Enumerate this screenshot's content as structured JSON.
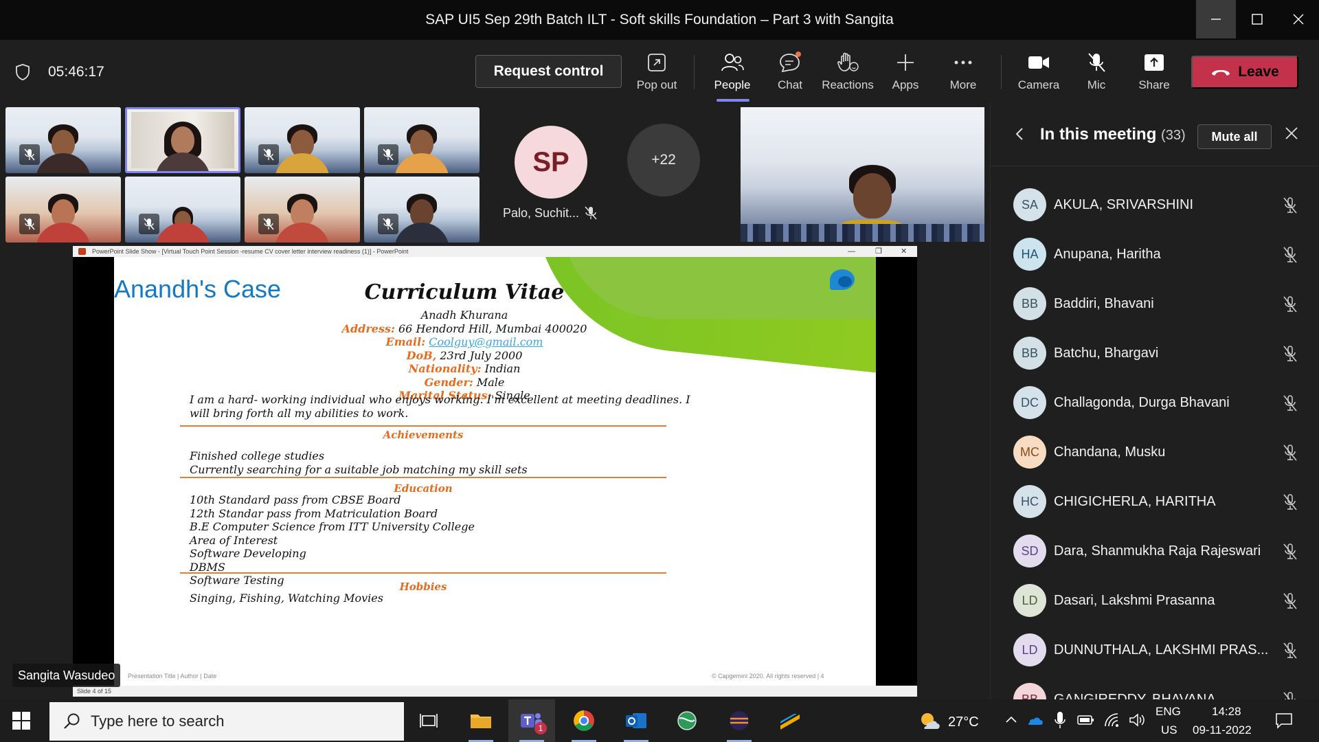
{
  "window": {
    "title": "SAP UI5 Sep 29th Batch ILT - Soft skills Foundation – Part 3 with Sangita"
  },
  "toolbar": {
    "timer": "05:46:17",
    "request_control": "Request control",
    "pop_out": "Pop out",
    "people": "People",
    "chat": "Chat",
    "reactions": "Reactions",
    "apps": "Apps",
    "more": "More",
    "camera": "Camera",
    "mic": "Mic",
    "share": "Share",
    "leave": "Leave"
  },
  "stage": {
    "avatar_initials": "SP",
    "avatar_name": "Palo, Suchit...",
    "overflow_count": "+22",
    "presenter_tag": "Sangita Wasudeo"
  },
  "ppt": {
    "window_title": "PowerPoint Slide Show - [Virtual Touch Point Session -resume CV cover letter interview readiness (1)] - PowerPoint",
    "slide_indicator": "Slide 4 of 15",
    "footer_left": "Presentation Title | Author | Date",
    "footer_right": "© Capgemini 2020. All rights reserved  |      4",
    "case_title": "Anandh's Case",
    "cv_heading": "Curriculum Vitae",
    "name": "Anadh Khurana",
    "address_label": "Address:",
    "address": " 66 Hendord Hill, Mumbai 400020",
    "email_label": "Email:",
    "email": "Coolguy@gmail.com",
    "dob_label": "DoB,",
    "dob": " 23rd July 2000",
    "nationality_label": "Nationality:",
    "nationality": " Indian",
    "gender_label": "Gender:",
    "gender": " Male",
    "marital_label": "Marital Status:",
    "marital": " Single",
    "summary_1": "I am a hard- working individual who enjoys working. I'm excellent at meeting deadlines. I",
    "summary_2": "will bring forth all my abilities to work.",
    "achievements_head": "Achievements",
    "achievements": [
      "Finished college studies",
      "Currently searching for a suitable job matching my skill sets"
    ],
    "education_head": "Education",
    "education": [
      "10th Standard pass from CBSE Board",
      "12th Standar pass from Matriculation Board",
      "B.E Computer Science from ITT University College",
      "Area of Interest",
      "Software Developing",
      "DBMS",
      "Software Testing"
    ],
    "hobbies_head": "Hobbies",
    "hobbies": "Singing, Fishing, Watching Movies"
  },
  "panel": {
    "title": "In this meeting",
    "count": "(33)",
    "mute_all": "Mute all",
    "participants": [
      {
        "initials": "SA",
        "name": "AKULA, SRIVARSHINI",
        "bg": "#d6e2ea",
        "fg": "#3c5166"
      },
      {
        "initials": "HA",
        "name": "Anupana, Haritha",
        "bg": "#cde3ee",
        "fg": "#1f5574"
      },
      {
        "initials": "BB",
        "name": "Baddiri, Bhavani",
        "bg": "#d3e0e6",
        "fg": "#36525f"
      },
      {
        "initials": "BB",
        "name": "Batchu, Bhargavi",
        "bg": "#d3e0e6",
        "fg": "#36525f"
      },
      {
        "initials": "DC",
        "name": "Challagonda, Durga Bhavani",
        "bg": "#d6e2ea",
        "fg": "#3c5166"
      },
      {
        "initials": "MC",
        "name": "Chandana, Musku",
        "bg": "#f7dcc3",
        "fg": "#8a4a17"
      },
      {
        "initials": "HC",
        "name": "CHIGICHERLA, HARITHA",
        "bg": "#d6e2ea",
        "fg": "#3c5166"
      },
      {
        "initials": "SD",
        "name": "Dara, Shanmukha Raja Rajeswari",
        "bg": "#e3dcef",
        "fg": "#5a4584"
      },
      {
        "initials": "LD",
        "name": "Dasari, Lakshmi Prasanna",
        "bg": "#dfe5d6",
        "fg": "#4e5e3b"
      },
      {
        "initials": "LD",
        "name": "DUNNUTHALA, LAKSHMI PRAS...",
        "bg": "#e3dcef",
        "fg": "#5a4584"
      },
      {
        "initials": "BB",
        "name": "GANGIREDDY, BHAVANA",
        "bg": "#f2d6da",
        "fg": "#7a2a34"
      }
    ]
  },
  "taskbar": {
    "search_placeholder": "Type here to search",
    "teams_badge": "1",
    "temperature": "27°C",
    "lang_1": "ENG",
    "lang_2": "US",
    "time": "14:28",
    "date": "09-11-2022"
  },
  "colors": {
    "accent": "#7f85f5",
    "leave": "#c4314b",
    "slide_orange": "#e46c1f",
    "slide_blue": "#1379c4",
    "slide_green": "#8bc53f"
  }
}
